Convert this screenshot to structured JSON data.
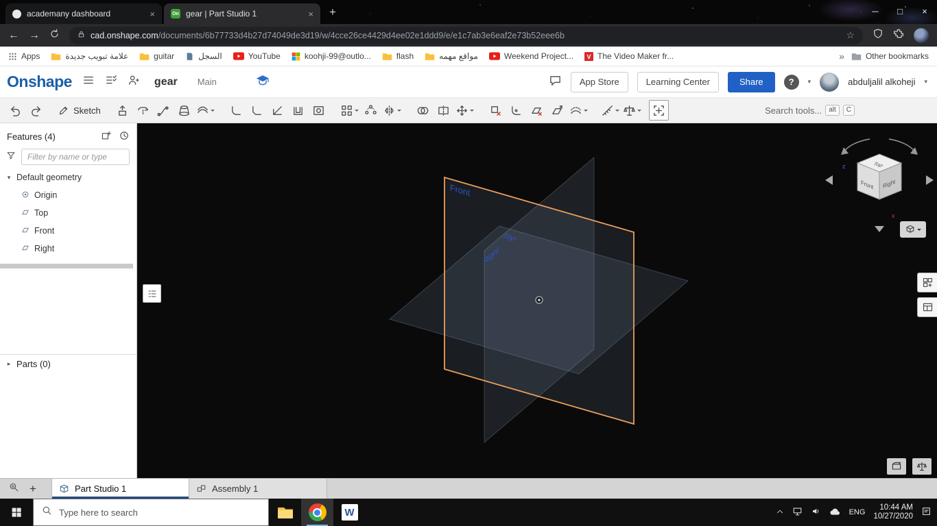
{
  "colors": {
    "onshape_blue": "#1b5faa",
    "share_button_blue": "#2160c4",
    "plane_highlight_orange": "#eb9e5e",
    "plane_label_blue": "#2d55c9",
    "viewport_background": "#0a0a0a",
    "active_tab_underline": "#274b7e",
    "chrome_frame": "#070707",
    "taskbar_background": "#101010"
  },
  "icons": {
    "back": "←",
    "forward": "→",
    "star": "☆",
    "overflow": "»",
    "minimize": "─",
    "maximize": "□",
    "close": "×",
    "new_tab": "+",
    "tab_close": "×",
    "caret": "▾",
    "chev_down": "▾",
    "chev_right": "▸",
    "onshape_favicon": "On",
    "word": "W",
    "help": "?"
  },
  "chrome": {
    "tab1_title": "academany dashboard",
    "tab2_title": "gear | Part Studio 1",
    "url_domain": "cad.onshape.com",
    "url_path": "/documents/6b77733d4b27d74049de3d19/w/4cce26ce4429d4ee02e1ddd9/e/e1c7ab3e6eaf2e73b52eee6b"
  },
  "bookmarks": {
    "apps": "Apps",
    "new_tab_arabic": "علامة تبويب جديدة",
    "guitar": "guitar",
    "history_arabic": "السجل",
    "youtube": "YouTube",
    "email": "koohji-99@outlo...",
    "flash": "flash",
    "sites_arabic": "مواقع مهمه",
    "weekend": "Weekend Project...",
    "videomaker": "The Video Maker fr...",
    "other": "Other bookmarks"
  },
  "header": {
    "logo": "Onshape",
    "doc_title": "gear",
    "workspace": "Main",
    "app_store": "App Store",
    "learning_center": "Learning Center",
    "share": "Share",
    "user_name": "abduljalil alkoheji"
  },
  "toolbar": {
    "sketch": "Sketch",
    "search_placeholder": "Search tools...",
    "kbd_alt": "alt",
    "kbd_c": "C",
    "icon_names": [
      "undo",
      "redo",
      "sketch",
      "extrude",
      "revolve",
      "sweep",
      "loft",
      "thicken",
      "fillet",
      "chamfer",
      "draft",
      "shell",
      "hole",
      "linear-pattern",
      "circular-pattern",
      "mirror",
      "boolean",
      "split",
      "transform",
      "delete-part",
      "modify-fillet",
      "delete-face",
      "move-face",
      "offset-surface",
      "measure",
      "mass-properties",
      "center-view"
    ]
  },
  "features": {
    "title": "Features (4)",
    "filter_placeholder": "Filter by name or type",
    "root": "Default geometry",
    "items": [
      "Origin",
      "Top",
      "Front",
      "Right"
    ],
    "parts": "Parts (0)"
  },
  "scene": {
    "front": "Front",
    "top": "Top",
    "right": "Right",
    "cube_top": "Top",
    "cube_front": "Front",
    "cube_right": "Right",
    "axis_x": "x",
    "axis_z": "z"
  },
  "bottom_tabs": {
    "tab1": "Part Studio 1",
    "tab2": "Assembly 1"
  },
  "taskbar": {
    "search_placeholder": "Type here to search",
    "lang": "ENG",
    "time": "10:44 AM",
    "date": "10/27/2020"
  }
}
